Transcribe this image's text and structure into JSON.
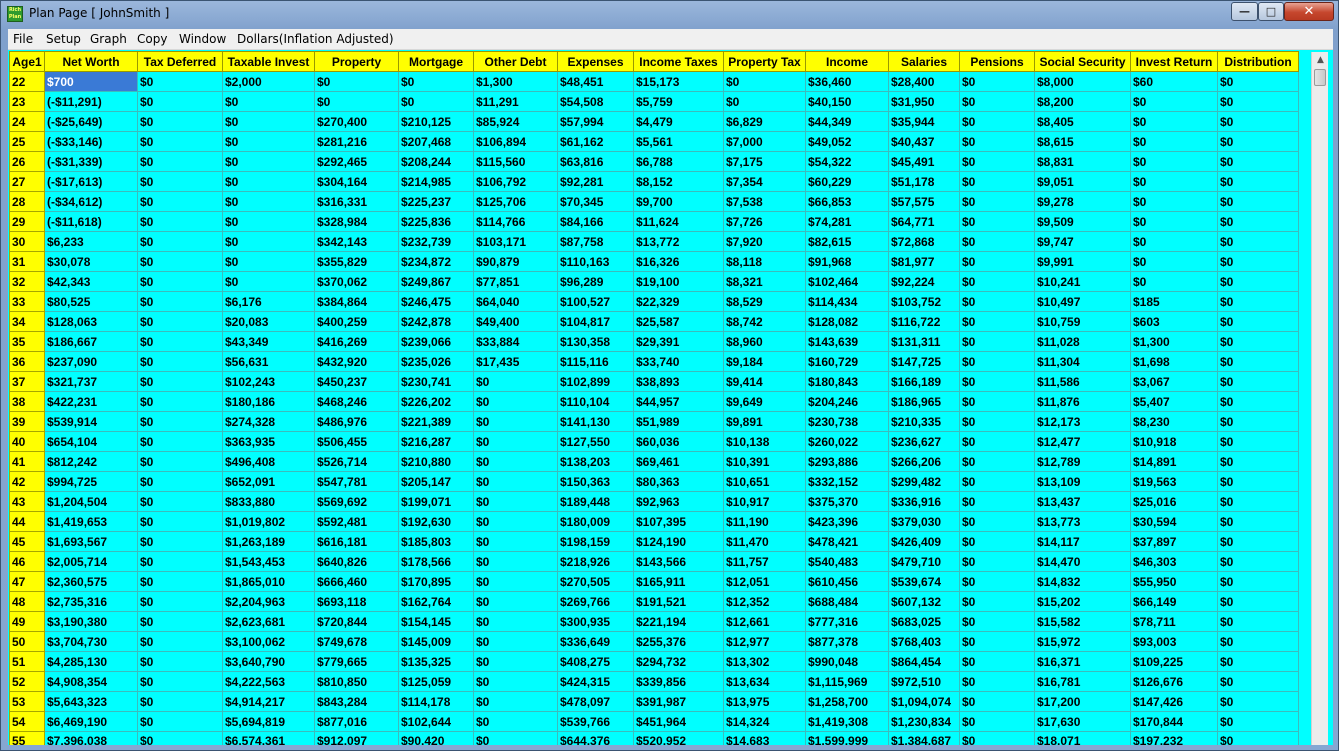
{
  "window": {
    "title": "Plan Page [ JohnSmith ]",
    "icon_text_top": "Rich",
    "icon_text_bottom": "Plan",
    "minimize": "—",
    "maximize": "□",
    "close": "✕"
  },
  "menu": [
    "File",
    "Setup",
    "Graph",
    "Copy",
    "Window",
    "Dollars(Inflation Adjusted)"
  ],
  "columns": [
    "Age1",
    "Net Worth",
    "Tax Deferred",
    "Taxable Invest",
    "Property",
    "Mortgage",
    "Other Debt",
    "Expenses",
    "Income Taxes",
    "Property Tax",
    "Income",
    "Salaries",
    "Pensions",
    "Social Security",
    "Invest Return",
    "Distribution"
  ],
  "rows": [
    [
      "22",
      "$700",
      "$0",
      "$2,000",
      "$0",
      "$0",
      "$1,300",
      "$48,451",
      "$15,173",
      "$0",
      "$36,460",
      "$28,400",
      "$0",
      "$8,000",
      "$60",
      "$0"
    ],
    [
      "23",
      "(-$11,291)",
      "$0",
      "$0",
      "$0",
      "$0",
      "$11,291",
      "$54,508",
      "$5,759",
      "$0",
      "$40,150",
      "$31,950",
      "$0",
      "$8,200",
      "$0",
      "$0"
    ],
    [
      "24",
      "(-$25,649)",
      "$0",
      "$0",
      "$270,400",
      "$210,125",
      "$85,924",
      "$57,994",
      "$4,479",
      "$6,829",
      "$44,349",
      "$35,944",
      "$0",
      "$8,405",
      "$0",
      "$0"
    ],
    [
      "25",
      "(-$33,146)",
      "$0",
      "$0",
      "$281,216",
      "$207,468",
      "$106,894",
      "$61,162",
      "$5,561",
      "$7,000",
      "$49,052",
      "$40,437",
      "$0",
      "$8,615",
      "$0",
      "$0"
    ],
    [
      "26",
      "(-$31,339)",
      "$0",
      "$0",
      "$292,465",
      "$208,244",
      "$115,560",
      "$63,816",
      "$6,788",
      "$7,175",
      "$54,322",
      "$45,491",
      "$0",
      "$8,831",
      "$0",
      "$0"
    ],
    [
      "27",
      "(-$17,613)",
      "$0",
      "$0",
      "$304,164",
      "$214,985",
      "$106,792",
      "$92,281",
      "$8,152",
      "$7,354",
      "$60,229",
      "$51,178",
      "$0",
      "$9,051",
      "$0",
      "$0"
    ],
    [
      "28",
      "(-$34,612)",
      "$0",
      "$0",
      "$316,331",
      "$225,237",
      "$125,706",
      "$70,345",
      "$9,700",
      "$7,538",
      "$66,853",
      "$57,575",
      "$0",
      "$9,278",
      "$0",
      "$0"
    ],
    [
      "29",
      "(-$11,618)",
      "$0",
      "$0",
      "$328,984",
      "$225,836",
      "$114,766",
      "$84,166",
      "$11,624",
      "$7,726",
      "$74,281",
      "$64,771",
      "$0",
      "$9,509",
      "$0",
      "$0"
    ],
    [
      "30",
      "$6,233",
      "$0",
      "$0",
      "$342,143",
      "$232,739",
      "$103,171",
      "$87,758",
      "$13,772",
      "$7,920",
      "$82,615",
      "$72,868",
      "$0",
      "$9,747",
      "$0",
      "$0"
    ],
    [
      "31",
      "$30,078",
      "$0",
      "$0",
      "$355,829",
      "$234,872",
      "$90,879",
      "$110,163",
      "$16,326",
      "$8,118",
      "$91,968",
      "$81,977",
      "$0",
      "$9,991",
      "$0",
      "$0"
    ],
    [
      "32",
      "$42,343",
      "$0",
      "$0",
      "$370,062",
      "$249,867",
      "$77,851",
      "$96,289",
      "$19,100",
      "$8,321",
      "$102,464",
      "$92,224",
      "$0",
      "$10,241",
      "$0",
      "$0"
    ],
    [
      "33",
      "$80,525",
      "$0",
      "$6,176",
      "$384,864",
      "$246,475",
      "$64,040",
      "$100,527",
      "$22,329",
      "$8,529",
      "$114,434",
      "$103,752",
      "$0",
      "$10,497",
      "$185",
      "$0"
    ],
    [
      "34",
      "$128,063",
      "$0",
      "$20,083",
      "$400,259",
      "$242,878",
      "$49,400",
      "$104,817",
      "$25,587",
      "$8,742",
      "$128,082",
      "$116,722",
      "$0",
      "$10,759",
      "$603",
      "$0"
    ],
    [
      "35",
      "$186,667",
      "$0",
      "$43,349",
      "$416,269",
      "$239,066",
      "$33,884",
      "$130,358",
      "$29,391",
      "$8,960",
      "$143,639",
      "$131,311",
      "$0",
      "$11,028",
      "$1,300",
      "$0"
    ],
    [
      "36",
      "$237,090",
      "$0",
      "$56,631",
      "$432,920",
      "$235,026",
      "$17,435",
      "$115,116",
      "$33,740",
      "$9,184",
      "$160,729",
      "$147,725",
      "$0",
      "$11,304",
      "$1,698",
      "$0"
    ],
    [
      "37",
      "$321,737",
      "$0",
      "$102,243",
      "$450,237",
      "$230,741",
      "$0",
      "$102,899",
      "$38,893",
      "$9,414",
      "$180,843",
      "$166,189",
      "$0",
      "$11,586",
      "$3,067",
      "$0"
    ],
    [
      "38",
      "$422,231",
      "$0",
      "$180,186",
      "$468,246",
      "$226,202",
      "$0",
      "$110,104",
      "$44,957",
      "$9,649",
      "$204,246",
      "$186,965",
      "$0",
      "$11,876",
      "$5,407",
      "$0"
    ],
    [
      "39",
      "$539,914",
      "$0",
      "$274,328",
      "$486,976",
      "$221,389",
      "$0",
      "$141,130",
      "$51,989",
      "$9,891",
      "$230,738",
      "$210,335",
      "$0",
      "$12,173",
      "$8,230",
      "$0"
    ],
    [
      "40",
      "$654,104",
      "$0",
      "$363,935",
      "$506,455",
      "$216,287",
      "$0",
      "$127,550",
      "$60,036",
      "$10,138",
      "$260,022",
      "$236,627",
      "$0",
      "$12,477",
      "$10,918",
      "$0"
    ],
    [
      "41",
      "$812,242",
      "$0",
      "$496,408",
      "$526,714",
      "$210,880",
      "$0",
      "$138,203",
      "$69,461",
      "$10,391",
      "$293,886",
      "$266,206",
      "$0",
      "$12,789",
      "$14,891",
      "$0"
    ],
    [
      "42",
      "$994,725",
      "$0",
      "$652,091",
      "$547,781",
      "$205,147",
      "$0",
      "$150,363",
      "$80,363",
      "$10,651",
      "$332,152",
      "$299,482",
      "$0",
      "$13,109",
      "$19,563",
      "$0"
    ],
    [
      "43",
      "$1,204,504",
      "$0",
      "$833,880",
      "$569,692",
      "$199,071",
      "$0",
      "$189,448",
      "$92,963",
      "$10,917",
      "$375,370",
      "$336,916",
      "$0",
      "$13,437",
      "$25,016",
      "$0"
    ],
    [
      "44",
      "$1,419,653",
      "$0",
      "$1,019,802",
      "$592,481",
      "$192,630",
      "$0",
      "$180,009",
      "$107,395",
      "$11,190",
      "$423,396",
      "$379,030",
      "$0",
      "$13,773",
      "$30,594",
      "$0"
    ],
    [
      "45",
      "$1,693,567",
      "$0",
      "$1,263,189",
      "$616,181",
      "$185,803",
      "$0",
      "$198,159",
      "$124,190",
      "$11,470",
      "$478,421",
      "$426,409",
      "$0",
      "$14,117",
      "$37,897",
      "$0"
    ],
    [
      "46",
      "$2,005,714",
      "$0",
      "$1,543,453",
      "$640,826",
      "$178,566",
      "$0",
      "$218,926",
      "$143,566",
      "$11,757",
      "$540,483",
      "$479,710",
      "$0",
      "$14,470",
      "$46,303",
      "$0"
    ],
    [
      "47",
      "$2,360,575",
      "$0",
      "$1,865,010",
      "$666,460",
      "$170,895",
      "$0",
      "$270,505",
      "$165,911",
      "$12,051",
      "$610,456",
      "$539,674",
      "$0",
      "$14,832",
      "$55,950",
      "$0"
    ],
    [
      "48",
      "$2,735,316",
      "$0",
      "$2,204,963",
      "$693,118",
      "$162,764",
      "$0",
      "$269,766",
      "$191,521",
      "$12,352",
      "$688,484",
      "$607,132",
      "$0",
      "$15,202",
      "$66,149",
      "$0"
    ],
    [
      "49",
      "$3,190,380",
      "$0",
      "$2,623,681",
      "$720,844",
      "$154,145",
      "$0",
      "$300,935",
      "$221,194",
      "$12,661",
      "$777,316",
      "$683,025",
      "$0",
      "$15,582",
      "$78,711",
      "$0"
    ],
    [
      "50",
      "$3,704,730",
      "$0",
      "$3,100,062",
      "$749,678",
      "$145,009",
      "$0",
      "$336,649",
      "$255,376",
      "$12,977",
      "$877,378",
      "$768,403",
      "$0",
      "$15,972",
      "$93,003",
      "$0"
    ],
    [
      "51",
      "$4,285,130",
      "$0",
      "$3,640,790",
      "$779,665",
      "$135,325",
      "$0",
      "$408,275",
      "$294,732",
      "$13,302",
      "$990,048",
      "$864,454",
      "$0",
      "$16,371",
      "$109,225",
      "$0"
    ],
    [
      "52",
      "$4,908,354",
      "$0",
      "$4,222,563",
      "$810,850",
      "$125,059",
      "$0",
      "$424,315",
      "$339,856",
      "$13,634",
      "$1,115,969",
      "$972,510",
      "$0",
      "$16,781",
      "$126,676",
      "$0"
    ],
    [
      "53",
      "$5,643,323",
      "$0",
      "$4,914,217",
      "$843,284",
      "$114,178",
      "$0",
      "$478,097",
      "$391,987",
      "$13,975",
      "$1,258,700",
      "$1,094,074",
      "$0",
      "$17,200",
      "$147,426",
      "$0"
    ],
    [
      "54",
      "$6,469,190",
      "$0",
      "$5,694,819",
      "$877,016",
      "$102,644",
      "$0",
      "$539,766",
      "$451,964",
      "$14,324",
      "$1,419,308",
      "$1,230,834",
      "$0",
      "$17,630",
      "$170,844",
      "$0"
    ],
    [
      "55",
      "$7,396,038",
      "$0",
      "$6,574,361",
      "$912,097",
      "$90,420",
      "$0",
      "$644,376",
      "$520,952",
      "$14,683",
      "$1,599,999",
      "$1,384,687",
      "$0",
      "$18,071",
      "$197,232",
      "$0"
    ]
  ],
  "selected_cell": {
    "row": 0,
    "col": 1
  }
}
